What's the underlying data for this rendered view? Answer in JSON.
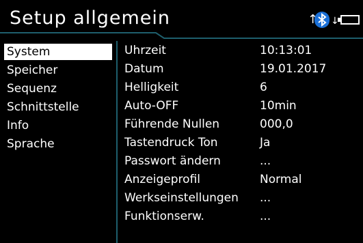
{
  "header": {
    "title": "Setup allgemein"
  },
  "status": {
    "icons": [
      "arrow-up-icon",
      "bluetooth-icon",
      "arrow-down-icon",
      "battery-icon"
    ],
    "bluetooth_color": "#1a6fd6"
  },
  "sidebar": {
    "items": [
      {
        "label": "System",
        "selected": true
      },
      {
        "label": "Speicher"
      },
      {
        "label": "Sequenz"
      },
      {
        "label": "Schnittstelle"
      },
      {
        "label": "Info"
      },
      {
        "label": "Sprache"
      }
    ]
  },
  "settings": {
    "rows": [
      {
        "label": "Uhrzeit",
        "value": "10:13:01"
      },
      {
        "label": "Datum",
        "value": "19.01.2017"
      },
      {
        "label": "Helligkeit",
        "value": "6"
      },
      {
        "label": "Auto-OFF",
        "value": "10min"
      },
      {
        "label": "Führende Nullen",
        "value": "000,0"
      },
      {
        "label": "Tastendruck Ton",
        "value": "Ja"
      },
      {
        "label": "Passwort ändern",
        "value": "..."
      },
      {
        "label": "Anzeigeprofil",
        "value": "Normal"
      },
      {
        "label": "Werkseinstellungen",
        "value": "..."
      },
      {
        "label": "Funktionserw.",
        "value": "..."
      }
    ]
  },
  "colors": {
    "background": "#000000",
    "accent_line": "#1e5f6d",
    "text": "#ffffff"
  }
}
